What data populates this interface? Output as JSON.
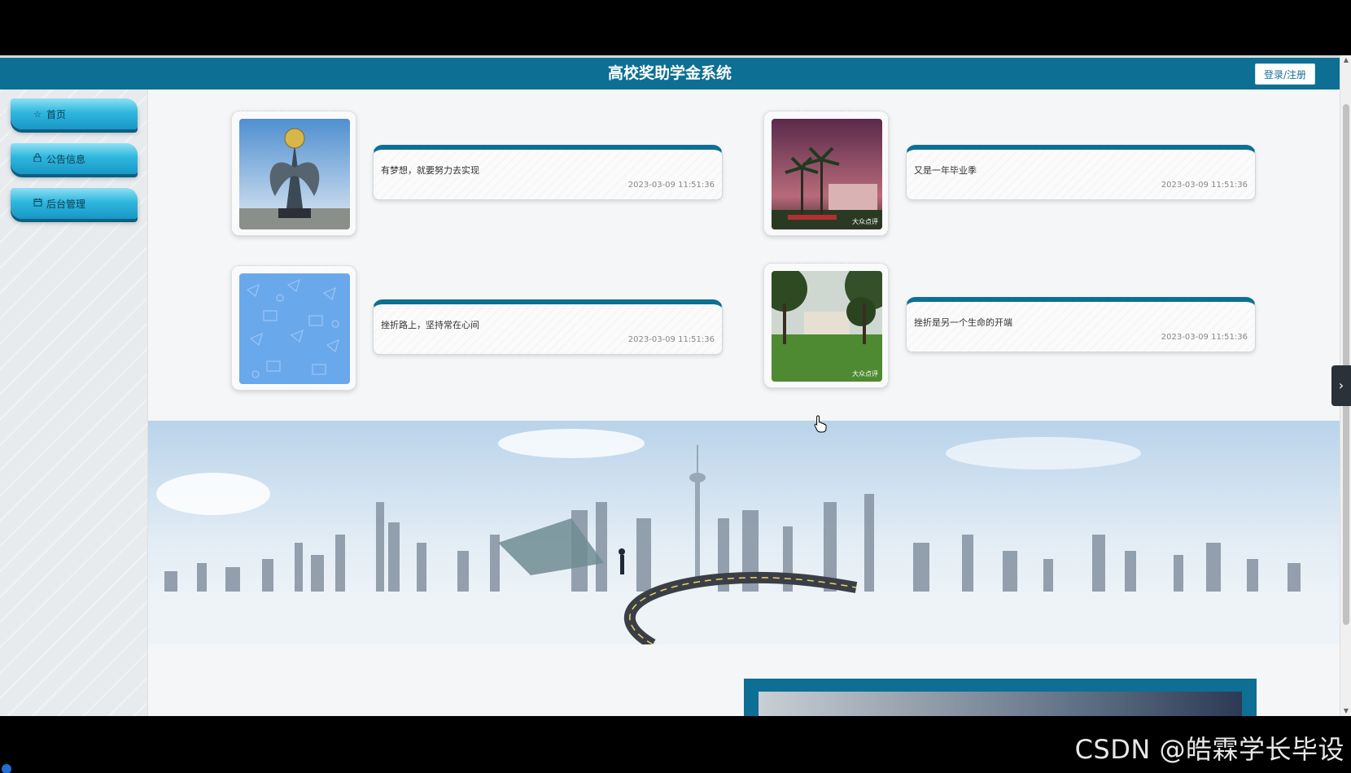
{
  "header": {
    "title": "高校奖助学金系统",
    "login_label": "登录/注册"
  },
  "sidebar": {
    "items": [
      {
        "label": "首页",
        "icon": "star-icon"
      },
      {
        "label": "公告信息",
        "icon": "lock-icon"
      },
      {
        "label": "后台管理",
        "icon": "calendar-icon"
      }
    ]
  },
  "news": [
    {
      "title": "有梦想，就要努力去实现",
      "date": "2023-03-09 11:51:36"
    },
    {
      "title": "又是一年毕业季",
      "date": "2023-03-09 11:51:36",
      "thumb_tag": "大众点评"
    },
    {
      "title": "挫折路上，坚持常在心间",
      "date": "2023-03-09 11:51:36"
    },
    {
      "title": "挫折是另一个生命的开端",
      "date": "2023-03-09 11:51:36",
      "thumb_tag": "大众点评"
    }
  ],
  "watermark": "CSDN @皓霖学长毕设",
  "colors": {
    "header": "#0d6f94",
    "nav": "#2fb7de"
  }
}
